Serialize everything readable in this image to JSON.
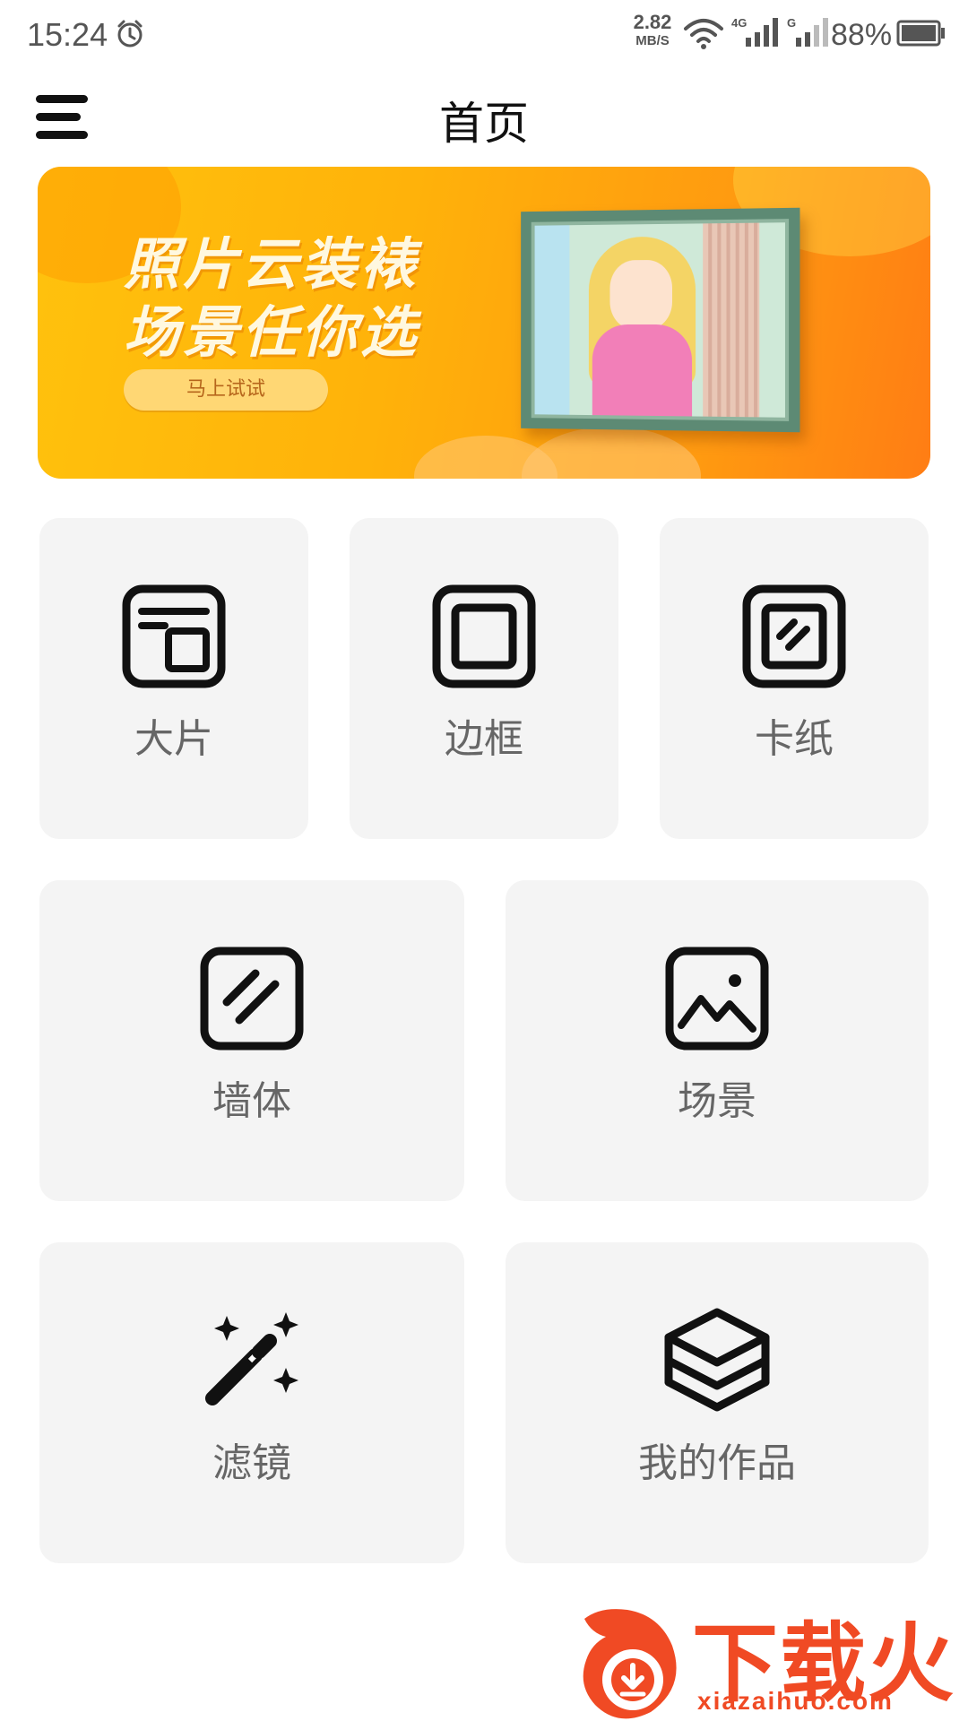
{
  "status_bar": {
    "time": "15:24",
    "net_speed_value": "2.82",
    "net_speed_unit": "MB/S",
    "sim1_type": "4G",
    "sim2_type": "G",
    "battery_percent": "88%",
    "alarm_icon": "alarm-clock-icon",
    "wifi_icon": "wifi-icon",
    "battery_icon": "battery-icon"
  },
  "header": {
    "title": "首页",
    "menu_icon": "hamburger-menu-icon"
  },
  "banner": {
    "line1": "照片云装裱",
    "line2": "场景任你选",
    "cta": "马上试试",
    "gradient_start": "#ffc20d",
    "gradient_end": "#ff7d14"
  },
  "tiles": [
    {
      "label": "大片",
      "icon": "large-photo-icon"
    },
    {
      "label": "边框",
      "icon": "border-frame-icon"
    },
    {
      "label": "卡纸",
      "icon": "cardboard-mat-icon"
    },
    {
      "label": "墙体",
      "icon": "wall-texture-icon"
    },
    {
      "label": "场景",
      "icon": "scene-picture-icon"
    },
    {
      "label": "滤镜",
      "icon": "magic-wand-icon"
    },
    {
      "label": "我的作品",
      "icon": "layers-stack-icon"
    }
  ],
  "watermark": {
    "brand": "下载火",
    "url": "xiazaihuo.com",
    "color": "#f04a24"
  },
  "colors": {
    "tile_bg": "#f4f4f4",
    "tile_label": "#666666",
    "icon_stroke": "#111111"
  }
}
